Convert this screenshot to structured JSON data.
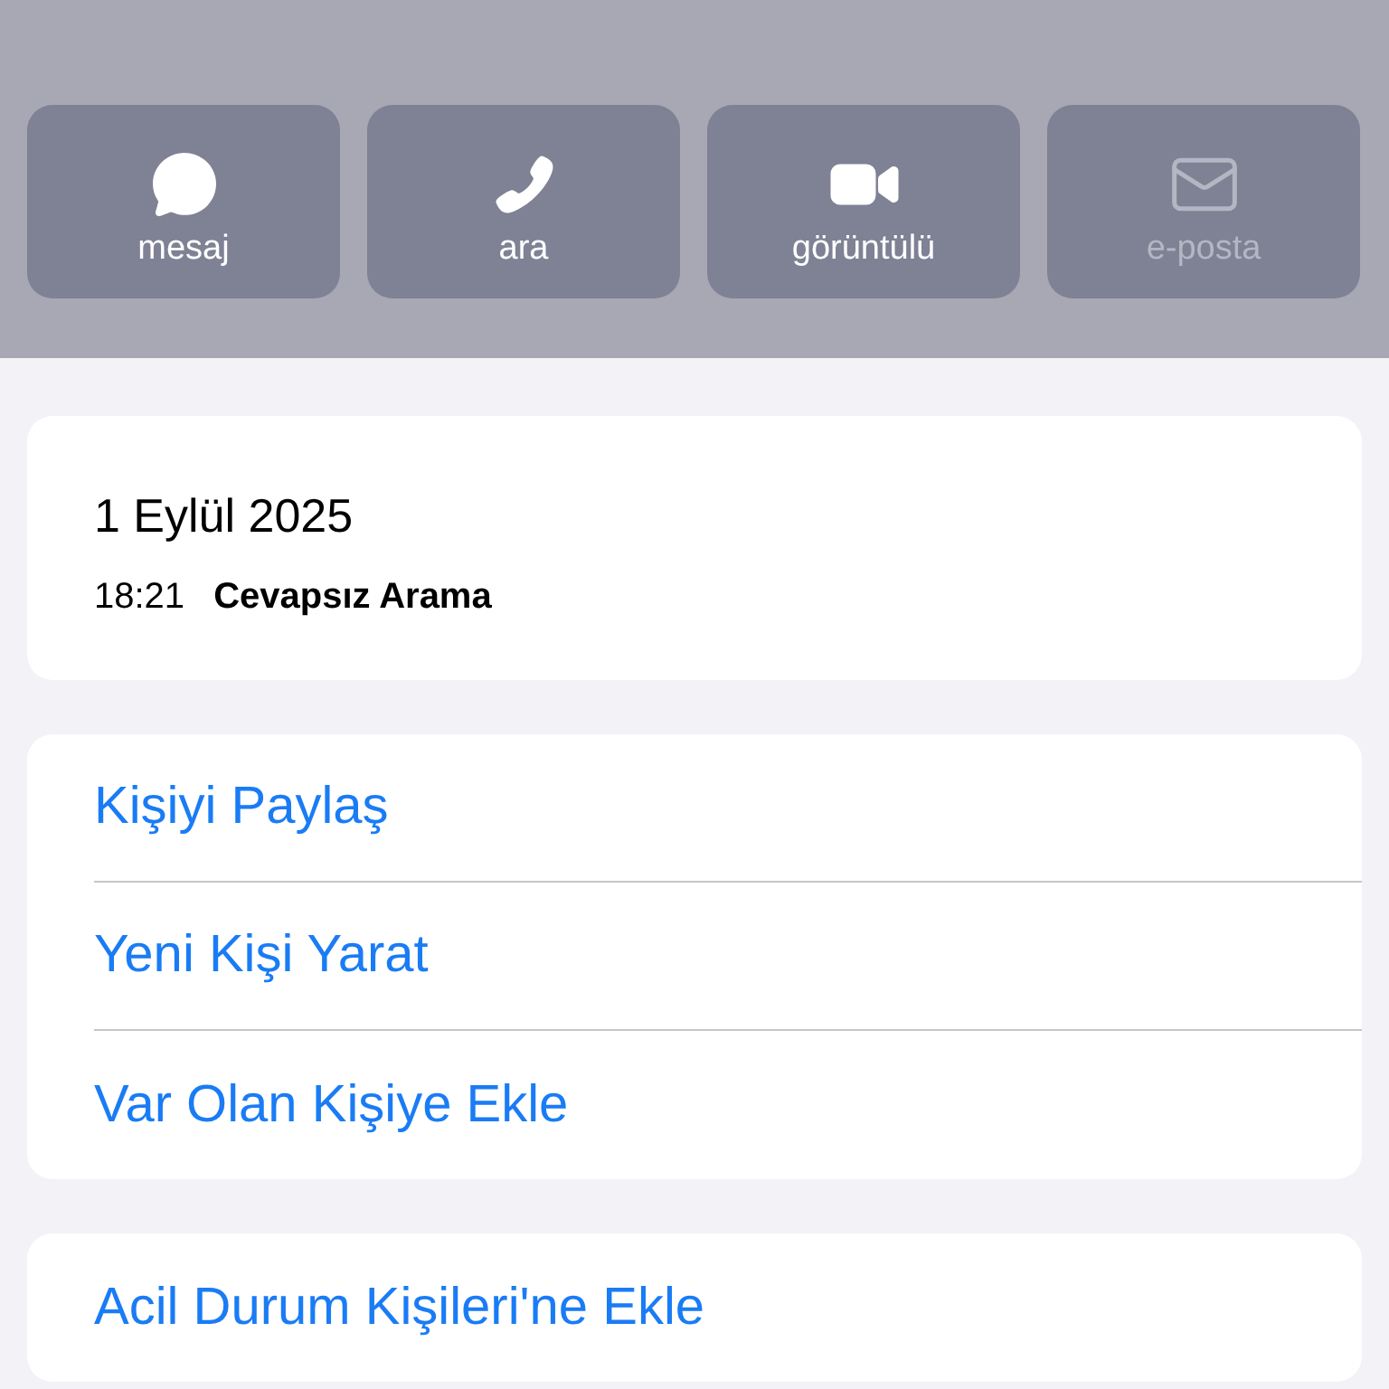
{
  "quick_actions": [
    {
      "label": "mesaj",
      "kind": "message",
      "disabled": false
    },
    {
      "label": "ara",
      "kind": "call",
      "disabled": false
    },
    {
      "label": "görüntülü",
      "kind": "video",
      "disabled": false
    },
    {
      "label": "e-posta",
      "kind": "mail",
      "disabled": true
    }
  ],
  "call_log": {
    "date": "1 Eylül 2025",
    "entries": [
      {
        "time": "18:21",
        "type": "Cevapsız Arama"
      }
    ]
  },
  "action_groups": [
    [
      "Kişiyi Paylaş",
      "Yeni Kişi Yarat",
      "Var Olan Kişiye Ekle"
    ],
    [
      "Acil Durum Kişileri'ne Ekle"
    ]
  ]
}
